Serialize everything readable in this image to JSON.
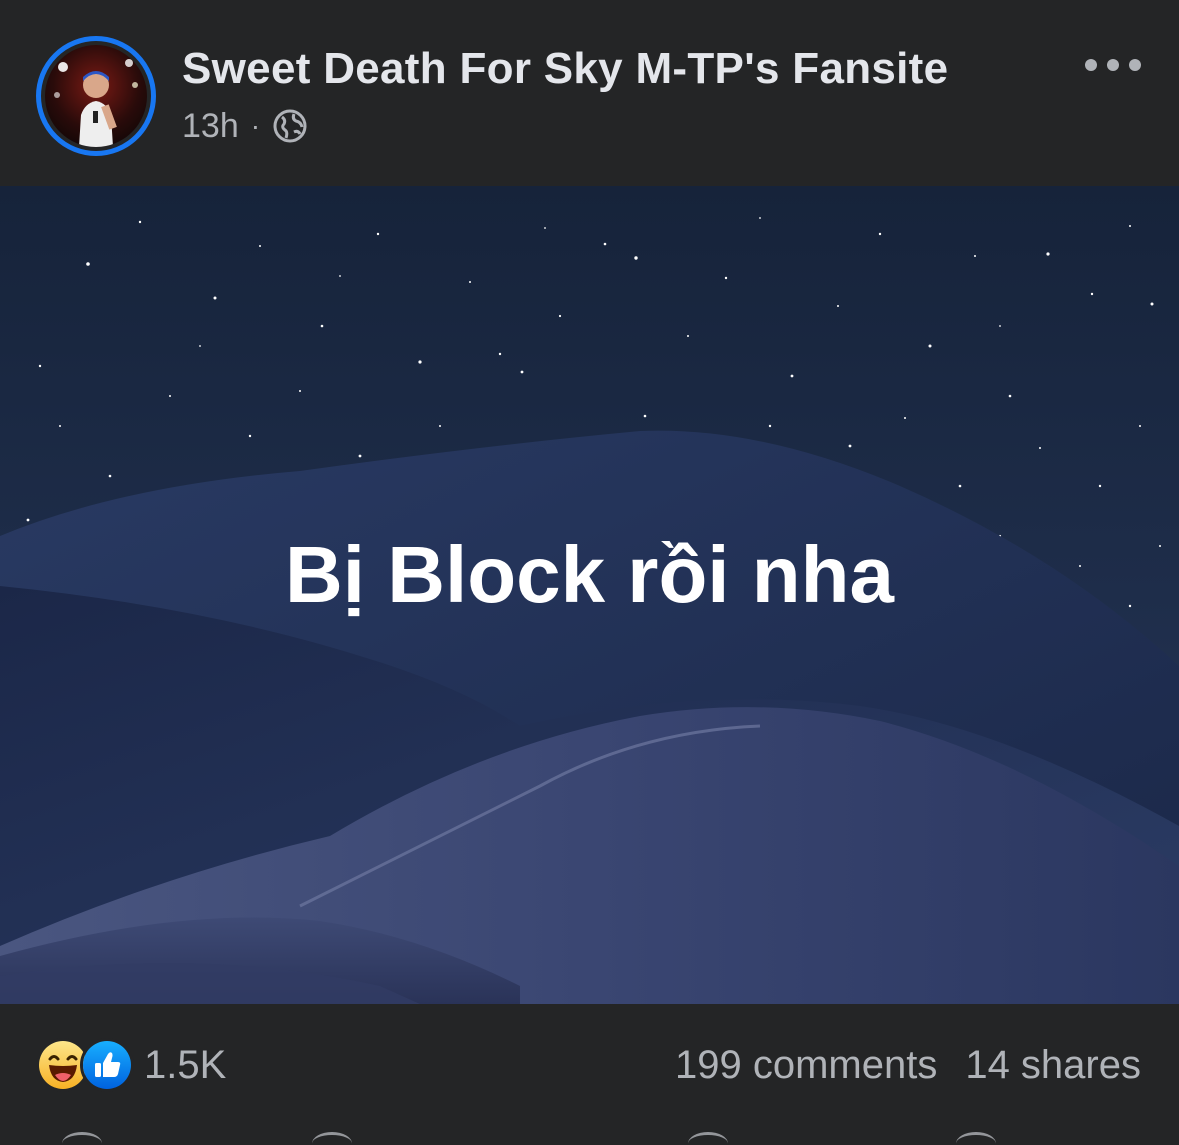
{
  "post": {
    "page_name": "Sweet Death For Sky M-TP's Fansite",
    "time": "13h",
    "separator": "·",
    "privacy_icon": "globe-icon",
    "more_icon": "more-options-icon",
    "image_text": "Bị Block rồi nha",
    "reactions": {
      "icons": [
        "haha-icon",
        "like-icon"
      ],
      "count": "1.5K"
    },
    "comments": "199 comments",
    "shares": "14 shares"
  },
  "colors": {
    "background": "#242526",
    "accent": "#1877f2",
    "secondary_text": "#b0b3b8",
    "primary_text": "#e4e6eb"
  }
}
